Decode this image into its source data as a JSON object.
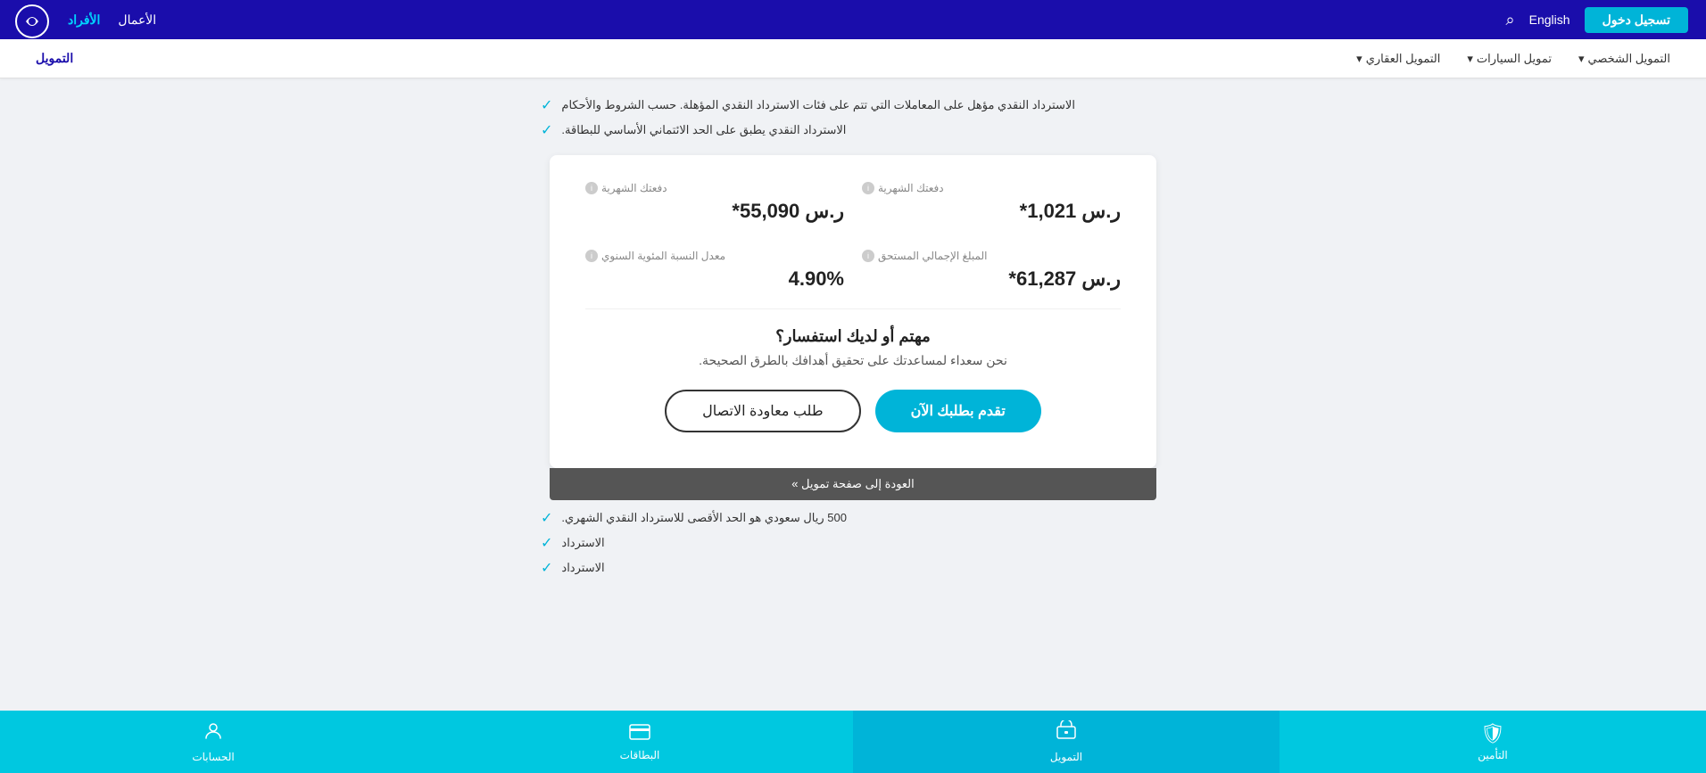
{
  "header": {
    "login_label": "تسجيل دخول",
    "english_label": "English",
    "nav_individuals": "الأفراد",
    "nav_business": "الأعمال"
  },
  "sub_nav": {
    "title": "التمويل",
    "items": [
      {
        "label": "التمويل العقاري",
        "has_chevron": true
      },
      {
        "label": "تمويل السيارات",
        "has_chevron": true
      },
      {
        "label": "التمويل الشخصي",
        "has_chevron": true
      }
    ]
  },
  "checklist": {
    "top_items": [
      "الاسترداد النقدي مؤهل على المعاملات التي تتم على فئات الاسترداد النقدي المؤهلة. حسب الشروط والأحكام",
      "الاسترداد النقدي يطبق على الحد الائتماني الأساسي للبطاقة."
    ],
    "bottom_items": [
      "500 ريال سعودي هو الحد الأقصى للاسترداد النقدي الشهري.",
      "الاسترداد",
      "الاسترداد"
    ]
  },
  "card": {
    "field1": {
      "label": "دفعتك الشهرية",
      "value": "ر.س 1,021*"
    },
    "field2": {
      "label": "دفعتك الشهرية",
      "value": "ر.س 55,090*"
    },
    "field3": {
      "label": "المبلغ الإجمالي المستحق",
      "value": "ر.س 61,287*"
    },
    "field4": {
      "label": "معدل النسبة المئوية السنوي",
      "value": "4.90%"
    }
  },
  "cta": {
    "title": "مهتم أو لديك استفسار؟",
    "subtitle": "نحن سعداء لمساعدتك على تحقيق أهدافك بالطرق الصحيحة.",
    "apply_btn": "تقدم بطلبك الآن",
    "callback_btn": "طلب معاودة الاتصال"
  },
  "back_bar": {
    "label": "العودة إلى صفحة تمويل »"
  },
  "bottom_nav": {
    "items": [
      {
        "label": "التأمين",
        "icon": "🛡️"
      },
      {
        "label": "التمويل",
        "icon": "💳"
      },
      {
        "label": "البطاقات",
        "icon": "💳"
      },
      {
        "label": "الحسابات",
        "icon": "👤"
      }
    ],
    "active_index": 1
  },
  "icons": {
    "check": "✓",
    "search": "🔍",
    "chevron_down": "▾",
    "info": "i"
  }
}
